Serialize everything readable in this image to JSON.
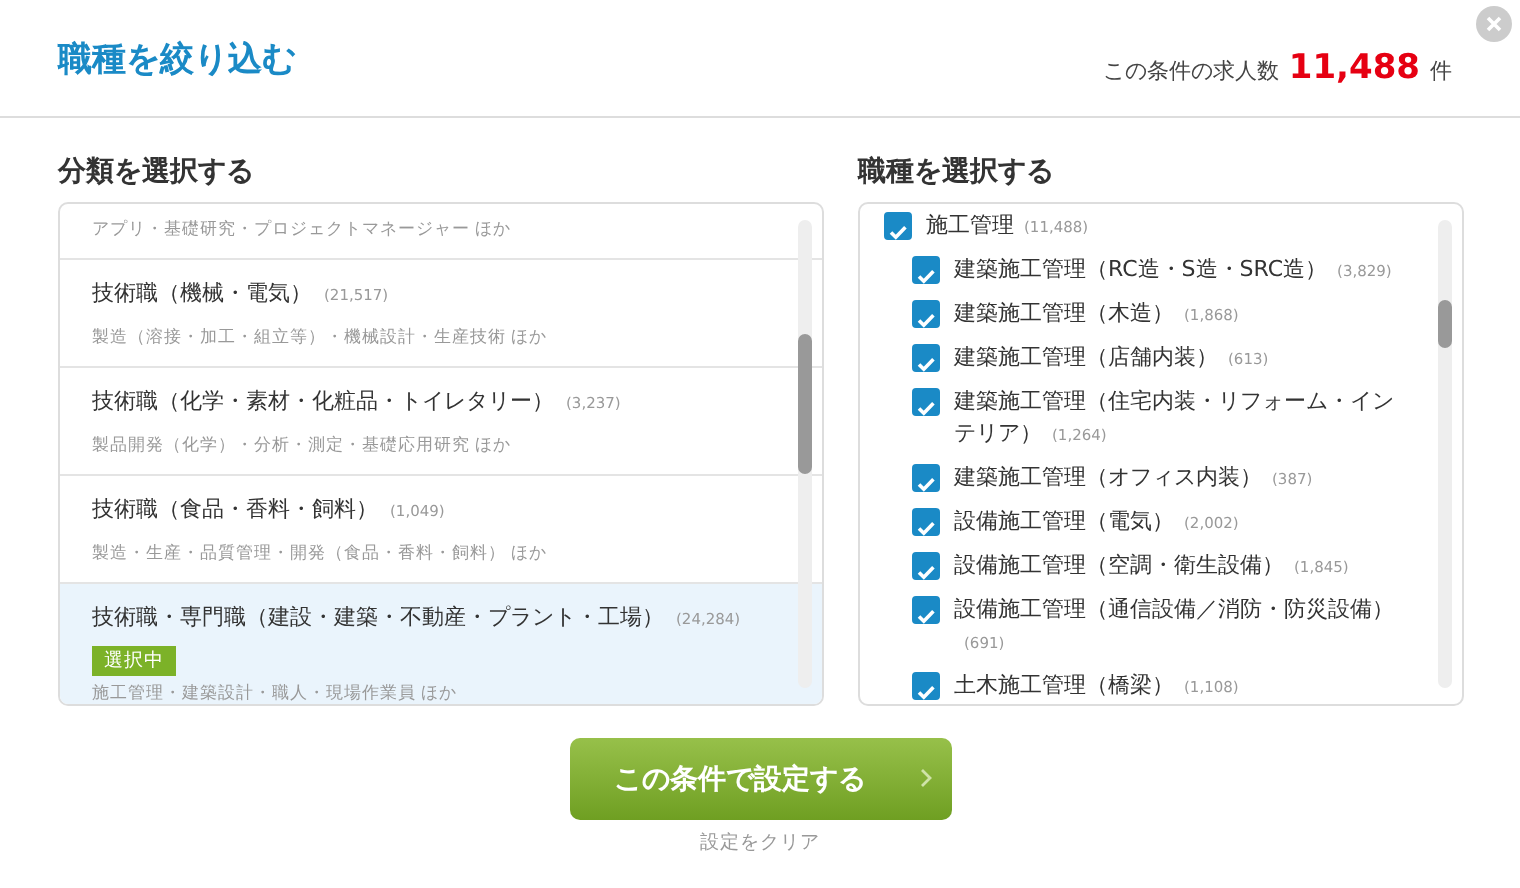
{
  "header": {
    "title": "職種を絞り込む",
    "count_label": "この条件の求人数",
    "count": "11,488",
    "count_unit": "件"
  },
  "categories": {
    "heading": "分類を選択する",
    "items": [
      {
        "description": "アプリ・基礎研究・プロジェクトマネージャー ほか",
        "selected": false
      },
      {
        "name": "技術職（機械・電気）",
        "count": "(21,517)",
        "description": "製造（溶接・加工・組立等）・機械設計・生産技術 ほか",
        "selected": false
      },
      {
        "name": "技術職（化学・素材・化粧品・トイレタリー）",
        "count": "(3,237)",
        "description": "製品開発（化学）・分析・測定・基礎応用研究 ほか",
        "selected": false
      },
      {
        "name": "技術職（食品・香料・飼料）",
        "count": "(1,049)",
        "description": "製造・生産・品質管理・開発（食品・香料・飼料） ほか",
        "selected": false
      },
      {
        "name": "技術職・専門職（建設・建築・不動産・プラント・工場）",
        "count": "(24,284)",
        "badge": "選択中",
        "description": "施工管理・建築設計・職人・現場作業員 ほか",
        "selected": true
      }
    ]
  },
  "jobs": {
    "heading": "職種を選択する",
    "items": [
      {
        "name": "施工管理",
        "count": "(11,488)",
        "checked": true,
        "children": [
          {
            "name": "建築施工管理（RC造・S造・SRC造）",
            "count": "(3,829)",
            "checked": true
          },
          {
            "name": "建築施工管理（木造）",
            "count": "(1,868)",
            "checked": true
          },
          {
            "name": "建築施工管理（店舗内装）",
            "count": "(613)",
            "checked": true
          },
          {
            "name": "建築施工管理（住宅内装・リフォーム・インテリア）",
            "count": "(1,264)",
            "checked": true
          },
          {
            "name": "建築施工管理（オフィス内装）",
            "count": "(387)",
            "checked": true
          },
          {
            "name": "設備施工管理（電気）",
            "count": "(2,002)",
            "checked": true
          },
          {
            "name": "設備施工管理（空調・衛生設備）",
            "count": "(1,845)",
            "checked": true
          },
          {
            "name": "設備施工管理（通信設備／消防・防災設備）",
            "count": "(691)",
            "checked": true
          },
          {
            "name": "土木施工管理（橋梁）",
            "count": "(1,108)",
            "checked": true
          }
        ]
      }
    ]
  },
  "footer": {
    "apply_button": "この条件で設定する",
    "clear_link": "設定をクリア"
  }
}
